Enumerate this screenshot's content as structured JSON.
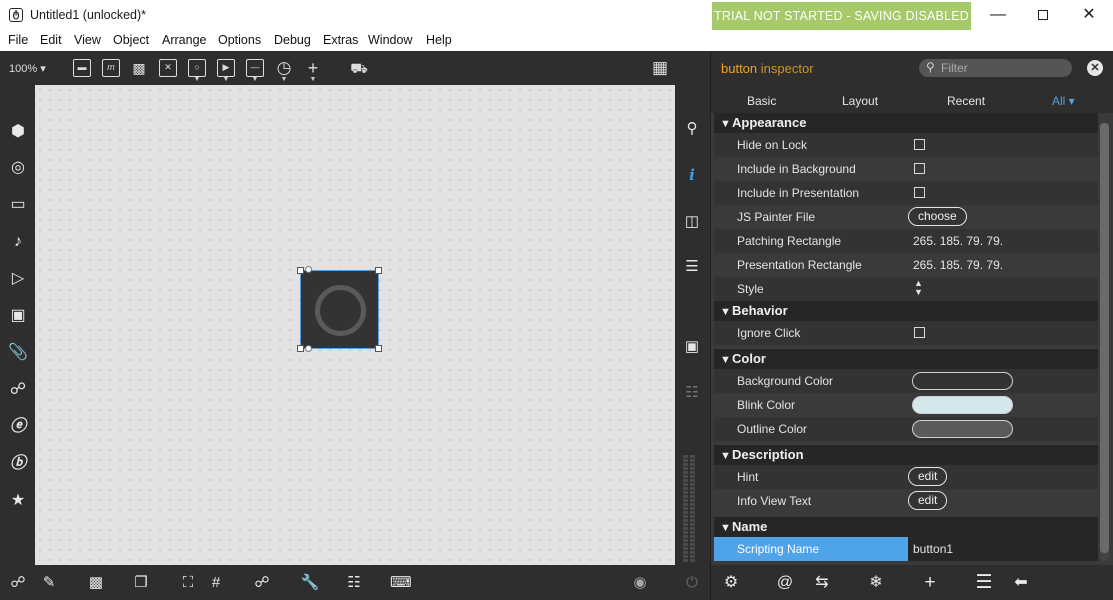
{
  "window": {
    "title": "Untitled1 (unlocked)*",
    "trial_banner": "TRIAL NOT STARTED - SAVING DISABLED",
    "app_icon": "max-logo-icon"
  },
  "menu": [
    "File",
    "Edit",
    "View",
    "Object",
    "Arrange",
    "Options",
    "Debug",
    "Extras",
    "Window",
    "Help"
  ],
  "toolbar": {
    "zoom": "100% ▾",
    "zoom_value": "100%"
  },
  "inspector": {
    "object": "button",
    "word": "inspector",
    "filter_placeholder": "Filter",
    "tabs": [
      "Basic",
      "Layout",
      "Recent",
      "All ▾"
    ],
    "active_tab": "All",
    "categories": {
      "appearance": "Appearance",
      "behavior": "Behavior",
      "color": "Color",
      "description": "Description",
      "name": "Name"
    },
    "rows": {
      "hide_on_lock": "Hide on Lock",
      "include_in_background": "Include in Background",
      "include_in_presentation": "Include in Presentation",
      "js_painter_file": "JS Painter File",
      "js_painter_button": "choose",
      "patching_rectangle": "Patching Rectangle",
      "patching_rectangle_value": "265. 185. 79. 79.",
      "presentation_rectangle": "Presentation Rectangle",
      "presentation_rectangle_value": "265. 185. 79. 79.",
      "style": "Style",
      "ignore_click": "Ignore Click",
      "background_color": "Background Color",
      "blink_color": "Blink Color",
      "outline_color": "Outline Color",
      "hint": "Hint",
      "hint_button": "edit",
      "info_view_text": "Info View Text",
      "info_view_button": "edit",
      "scripting_name": "Scripting Name",
      "scripting_name_value": "button1"
    },
    "colors": {
      "background_color": "#333333",
      "blink_color": "#d3e7ec",
      "outline_color": "#5a5a5a"
    }
  },
  "colors": {
    "accent_blue": "#4fa3e8",
    "accent_orange": "#f0a520",
    "trial_green": "#a6c96a"
  }
}
